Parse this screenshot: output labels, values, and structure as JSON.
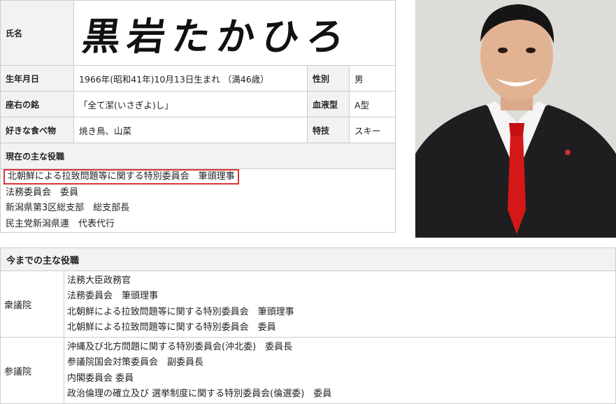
{
  "profile": {
    "name_label": "氏名",
    "name_value": "黒岩たかひろ",
    "birth_label": "生年月日",
    "birth_value": "1966年(昭和41年)10月13日生まれ （満46歳）",
    "sex_label": "性別",
    "sex_value": "男",
    "motto_label": "座右の銘",
    "motto_value": "「全て潔(いさぎよ)し」",
    "blood_label": "血液型",
    "blood_value": "A型",
    "food_label": "好きな食べ物",
    "food_value": "焼き鳥、山菜",
    "skill_label": "特技",
    "skill_value": "スキー"
  },
  "current_roles": {
    "title": "現在の主な役職",
    "items": [
      "北朝鮮による拉致問題等に関する特別委員会　筆頭理事",
      "法務委員会　委員",
      "新潟県第3区総支部　総支部長",
      "民主党新潟県連　代表代行"
    ]
  },
  "past_roles": {
    "title": "今までの主な役職",
    "groups": [
      {
        "house": "衆議院",
        "items": [
          "法務大臣政務官",
          "法務委員会　筆頭理事",
          "北朝鮮による拉致問題等に関する特別委員会　筆頭理事",
          "北朝鮮による拉致問題等に関する特別委員会　委員"
        ]
      },
      {
        "house": "参議院",
        "items": [
          "沖縄及び北方問題に関する特別委員会(沖北委)　委員長",
          "参議院国会対策委員会　副委員長",
          "内閣委員会 委員",
          "政治倫理の確立及び 選挙制度に関する特別委員会(倫選委)　委員"
        ]
      }
    ]
  },
  "colors": {
    "highlight_border": "#dd3333",
    "label_bg": "#f2f2f2",
    "border": "#cccccc"
  }
}
